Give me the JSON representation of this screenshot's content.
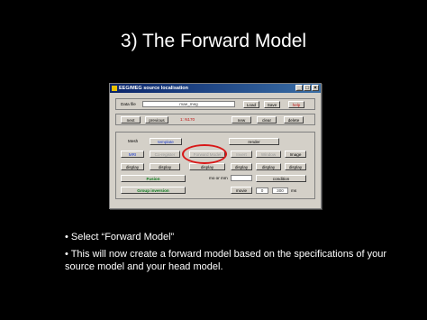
{
  "slide": {
    "title": "3) The Forward Model"
  },
  "window": {
    "title": "EEG/MEG source localisation",
    "controls": [
      "_",
      "□",
      "×"
    ]
  },
  "top": {
    "data_file_label": "Data file",
    "data_file_value": "mae_meg",
    "load": "Load",
    "save": "Save",
    "help": "help"
  },
  "nav": {
    "next": "next",
    "previous": "previous",
    "status": "1: N170",
    "new": "new",
    "clear": "clear",
    "delete": "delete"
  },
  "mesh": {
    "mesh_label": "Mesh",
    "template": "template",
    "render": "render",
    "mri": "MRI",
    "compute": "Co-register",
    "forward_model": "Forward Model",
    "invert": "Invert",
    "window": "Window",
    "image": "Image",
    "display": "display",
    "fusion": "Fusion",
    "mo_or_mm": "mo or mm",
    "condition": "condition",
    "group_inversion": "Group inversion",
    "movie": "movie",
    "t0": "0",
    "t1": "300",
    "ms": "ms"
  },
  "bullets": [
    "• Select “Forward Model”",
    "• This will now create a forward model based on the specifications of your source model and your head model."
  ],
  "colors": {
    "highlight_ring": "#d81818",
    "titlebar": "#0a246a"
  }
}
